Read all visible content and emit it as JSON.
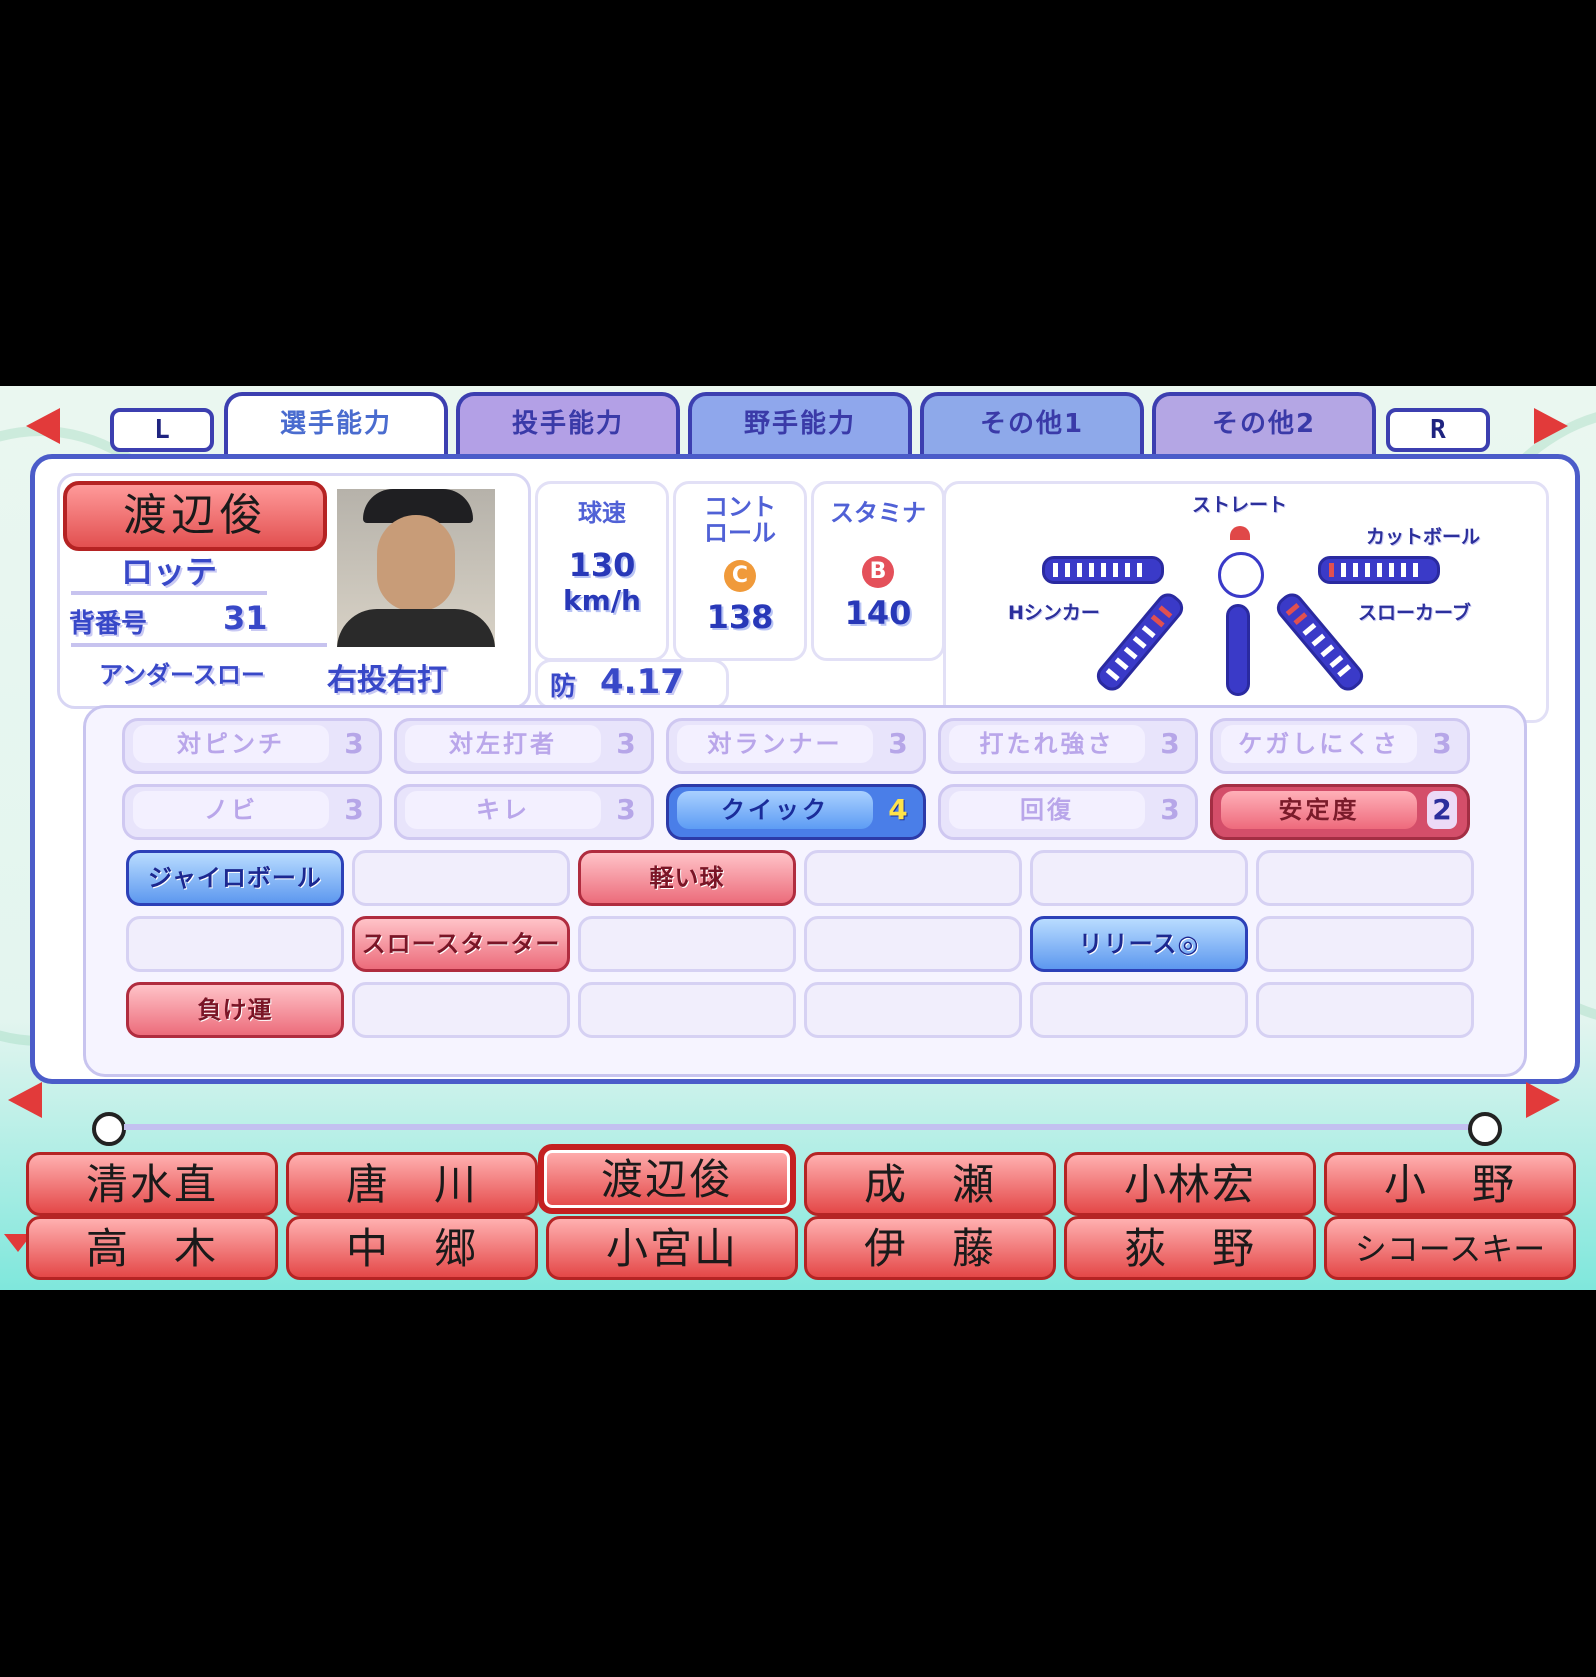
{
  "tabs": {
    "l_button": "L",
    "r_button": "R",
    "items": [
      {
        "label": "選手能力"
      },
      {
        "label": "投手能力"
      },
      {
        "label": "野手能力"
      },
      {
        "label": "その他1"
      },
      {
        "label": "その他2"
      }
    ]
  },
  "player": {
    "name": "渡辺俊",
    "team": "ロッテ",
    "number_label": "背番号",
    "number": "31",
    "style": "アンダースロー",
    "hand": "右投右打",
    "era_label": "防",
    "era": "4.17"
  },
  "stats": {
    "speed": {
      "title": "球速",
      "value": "130",
      "unit": "km/h"
    },
    "control": {
      "title_1": "コント",
      "title_2": "ロール",
      "rank": "C",
      "value": "138"
    },
    "stamina": {
      "title": "スタミナ",
      "rank": "B",
      "value": "140"
    }
  },
  "pitches": {
    "straight": "ストレート",
    "cut": "カットボール",
    "hsinker": "Hシンカー",
    "slowcurve": "スローカーブ"
  },
  "abilities_row1": [
    {
      "name": "対ピンチ",
      "value": "3"
    },
    {
      "name": "対左打者",
      "value": "3"
    },
    {
      "name": "対ランナー",
      "value": "3"
    },
    {
      "name": "打たれ強さ",
      "value": "3"
    },
    {
      "name": "ケガしにくさ",
      "value": "3"
    }
  ],
  "abilities_row2": [
    {
      "name": "ノビ",
      "value": "3"
    },
    {
      "name": "キレ",
      "value": "3"
    },
    {
      "name": "クイック",
      "value": "4"
    },
    {
      "name": "回復",
      "value": "3"
    },
    {
      "name": "安定度",
      "value": "2"
    }
  ],
  "special": {
    "gyro": "ジャイロボール",
    "light": "軽い球",
    "slowstarter": "スロースターター",
    "release": "リリース◎",
    "lose": "負け運"
  },
  "roster_row1": [
    "清水直",
    "唐　川",
    "渡辺俊",
    "成　瀬",
    "小林宏",
    "小　野"
  ],
  "roster_row2": [
    "高　木",
    "中　郷",
    "小宮山",
    "伊　藤",
    "荻　野",
    "シコースキー"
  ],
  "colors": {
    "accent_blue": "#4b5cc9",
    "accent_red": "#e44848"
  },
  "icons": {
    "left": "left-arrow-icon",
    "right": "right-arrow-icon",
    "square": "square-button-icon",
    "triangle": "triangle-button-icon"
  }
}
